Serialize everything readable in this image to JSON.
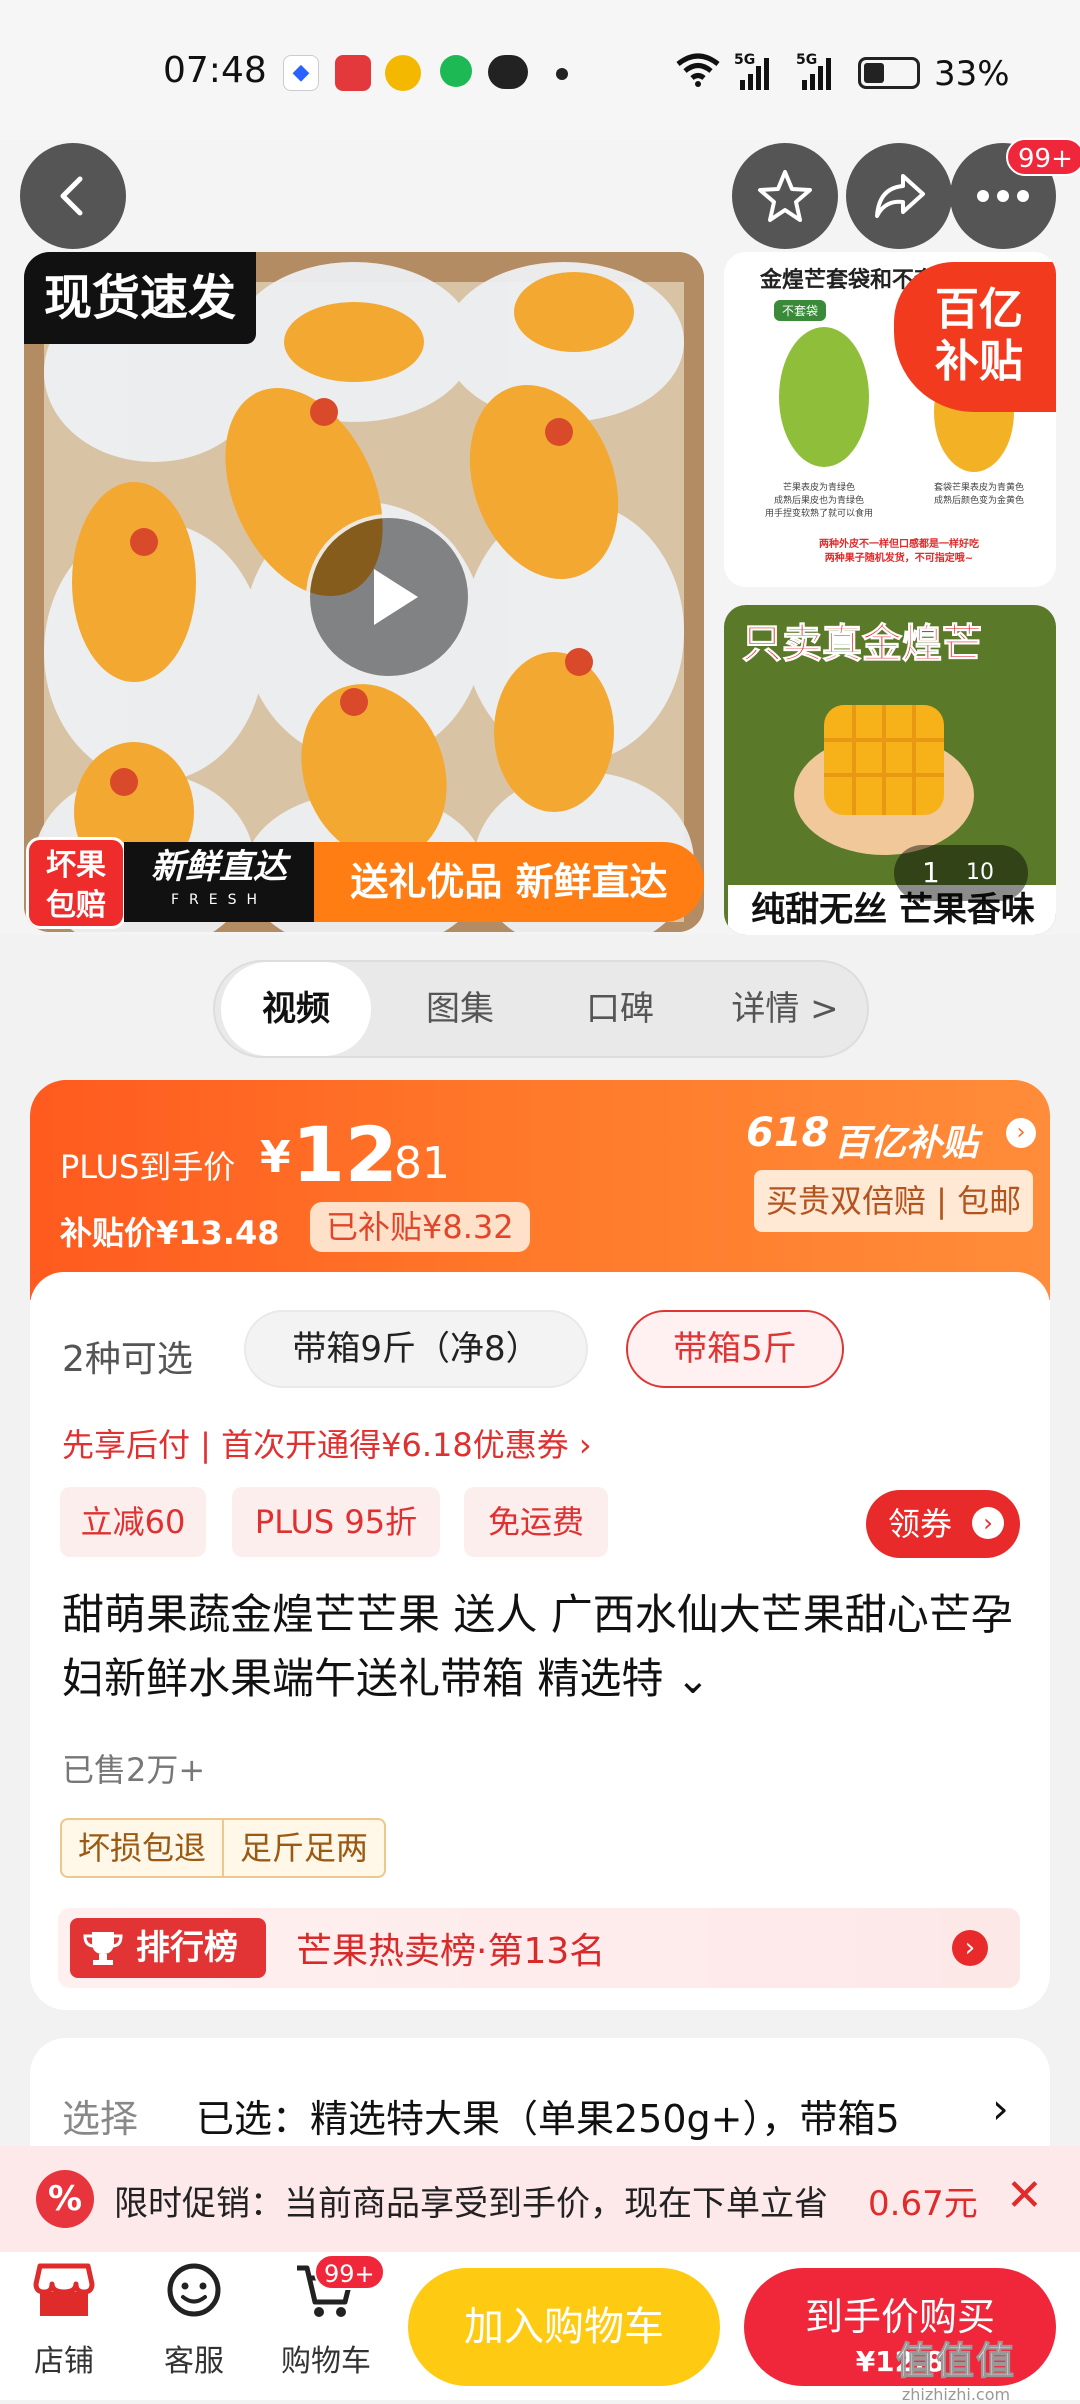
{
  "status_bar": {
    "time": "07:48",
    "net1": "5G",
    "net2": "5G",
    "battery": "33%"
  },
  "top_actions": {
    "more_badge": "99+"
  },
  "gallery": {
    "main_tag": "现货速发",
    "badge_line1": "坏果",
    "badge_line2": "包赔",
    "fresh_text": "新鲜直达",
    "fresh_en": "FRESH",
    "banner": "送礼优品 新鲜直达",
    "side1_title": "金煌芒套袋和不套",
    "side1_sub1": "不套袋",
    "side1_cap1": "芒果表皮为青绿色\n成熟后果皮也为青绿色\n用手捏变软熟了就可以食用",
    "side1_cap2": "套袋芒果表皮为青黄色\n成熟后颜色变为金黄色",
    "side1_note": "两种外皮不一样但口感都是一样好吃\n两种果子随机发货，不可指定哦~",
    "subsidy_badge_1": "百亿",
    "subsidy_badge_2": "补贴",
    "side2_top": "只卖真金煌芒",
    "side2_bottom": "纯甜无丝 芒果香味",
    "page_current": "1",
    "page_total": "10"
  },
  "tabs": [
    "视频",
    "图集",
    "口碑",
    "详情 >"
  ],
  "price": {
    "plus_label": "PLUS到手价",
    "currency": "¥",
    "int": "12",
    "dec": ".81",
    "subsidy_price": "补贴价¥13.48",
    "subsidized": "已补贴¥8.32",
    "event": "618",
    "event_brand": "百亿补贴",
    "guarantee": "买贵双倍赔 | 包邮"
  },
  "options": {
    "label": "2种可选",
    "opt1": "带箱9斤（净8）",
    "opt2": "带箱5斤"
  },
  "pay_later": "先享后付 | 首次开通得¥6.18优惠券 ›",
  "tags": [
    "立减60",
    "PLUS 95折",
    "免运费"
  ],
  "coupon": "领券",
  "title": "甜萌果蔬金煌芒芒果 送人 广西水仙大芒果甜心芒孕妇新鲜水果端午送礼带箱 精选特",
  "sold": "已售2万+",
  "service_tags": [
    "坏损包退",
    "足斤足两"
  ],
  "rank": {
    "label": "排行榜",
    "text": "芒果热卖榜·第13名"
  },
  "select": {
    "label": "选择",
    "value": "已选：精选特大果（单果250g+），带箱5"
  },
  "promo": {
    "text": "限时促销：当前商品享受到手价，现在下单立省",
    "amount": "0.67元"
  },
  "bottom_nav": {
    "shop": "店铺",
    "service": "客服",
    "cart": "购物车",
    "cart_badge": "99+"
  },
  "buttons": {
    "add_cart": "加入购物车",
    "buy": "到手价购买",
    "buy_price": "¥12.8"
  },
  "watermark": {
    "site": "值值值",
    "url": "zhizhizhi.com"
  },
  "colors": {
    "accent": "#f0273b",
    "orange": "#ff6a24",
    "yellow": "#ffcb12"
  }
}
